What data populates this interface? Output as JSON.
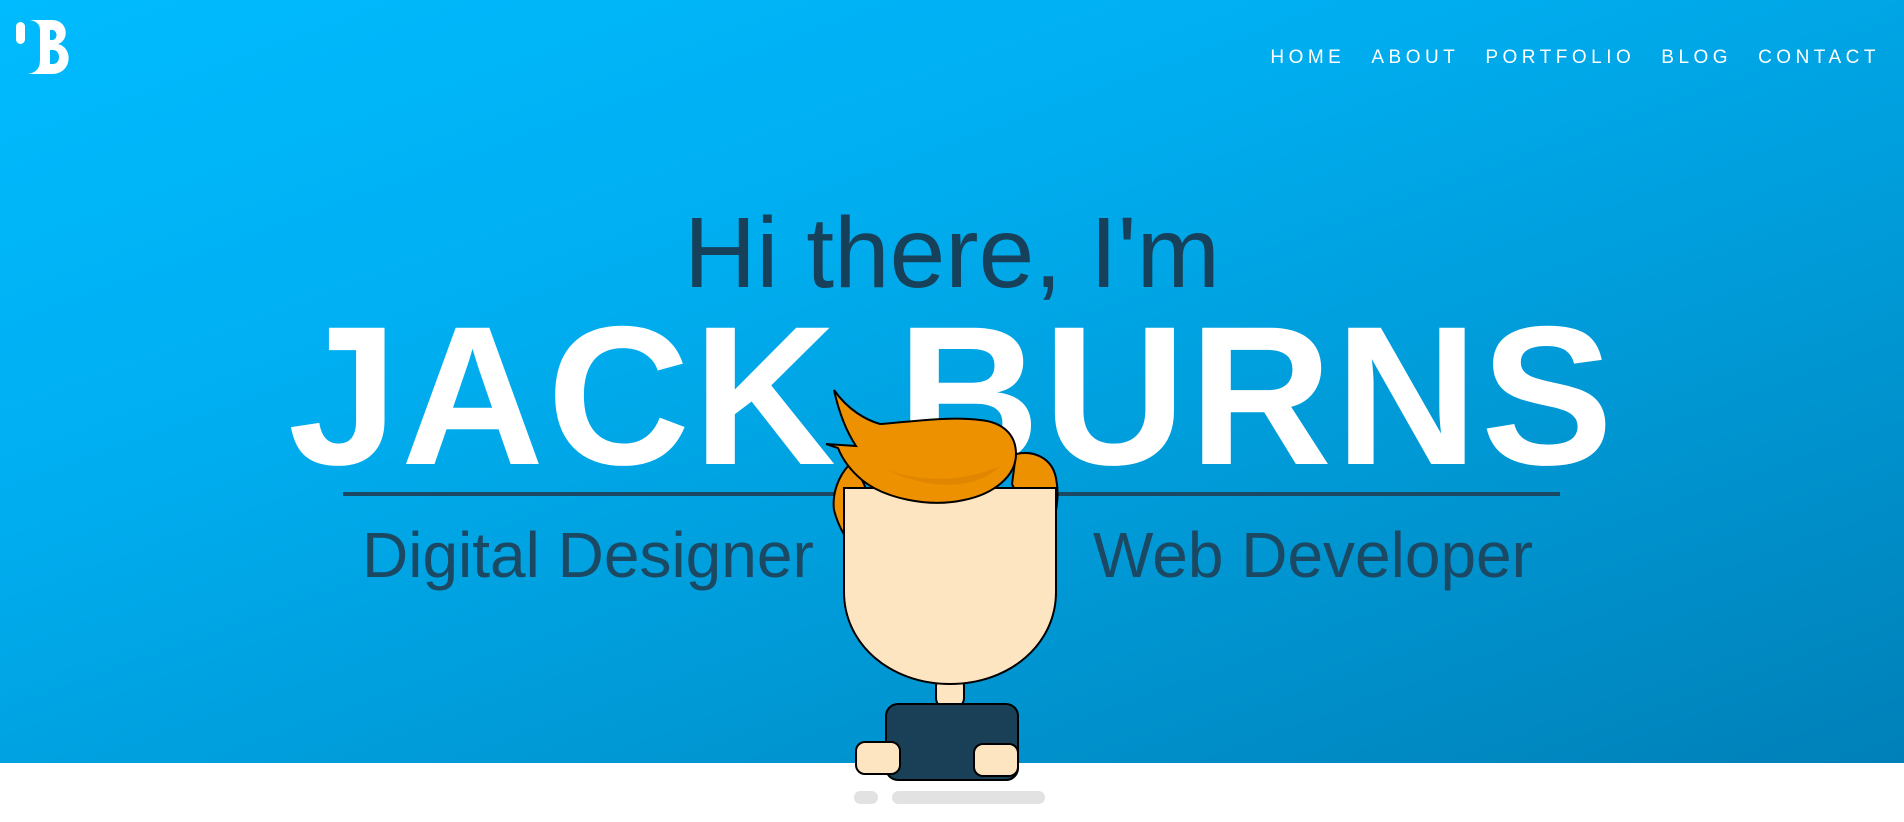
{
  "logo": {
    "text": "JB",
    "icon": "jb-monogram-logo"
  },
  "nav": {
    "items": [
      {
        "label": "HOME"
      },
      {
        "label": "ABOUT"
      },
      {
        "label": "PORTFOLIO"
      },
      {
        "label": "BLOG"
      },
      {
        "label": "CONTACT"
      }
    ]
  },
  "hero": {
    "greeting": "Hi there, I'm",
    "name": "JACK BURNS",
    "role_left": "Digital Designer",
    "role_right": "Web Developer",
    "avatar_icon": "cartoon-avatar-icon"
  },
  "colors": {
    "hero_gradient_start": "#00bbff",
    "hero_gradient_end": "#0080b8",
    "dark_text": "#1b4862",
    "hair": "#ee9100",
    "skin": "#fde5c2",
    "shirt": "#1a4057"
  }
}
